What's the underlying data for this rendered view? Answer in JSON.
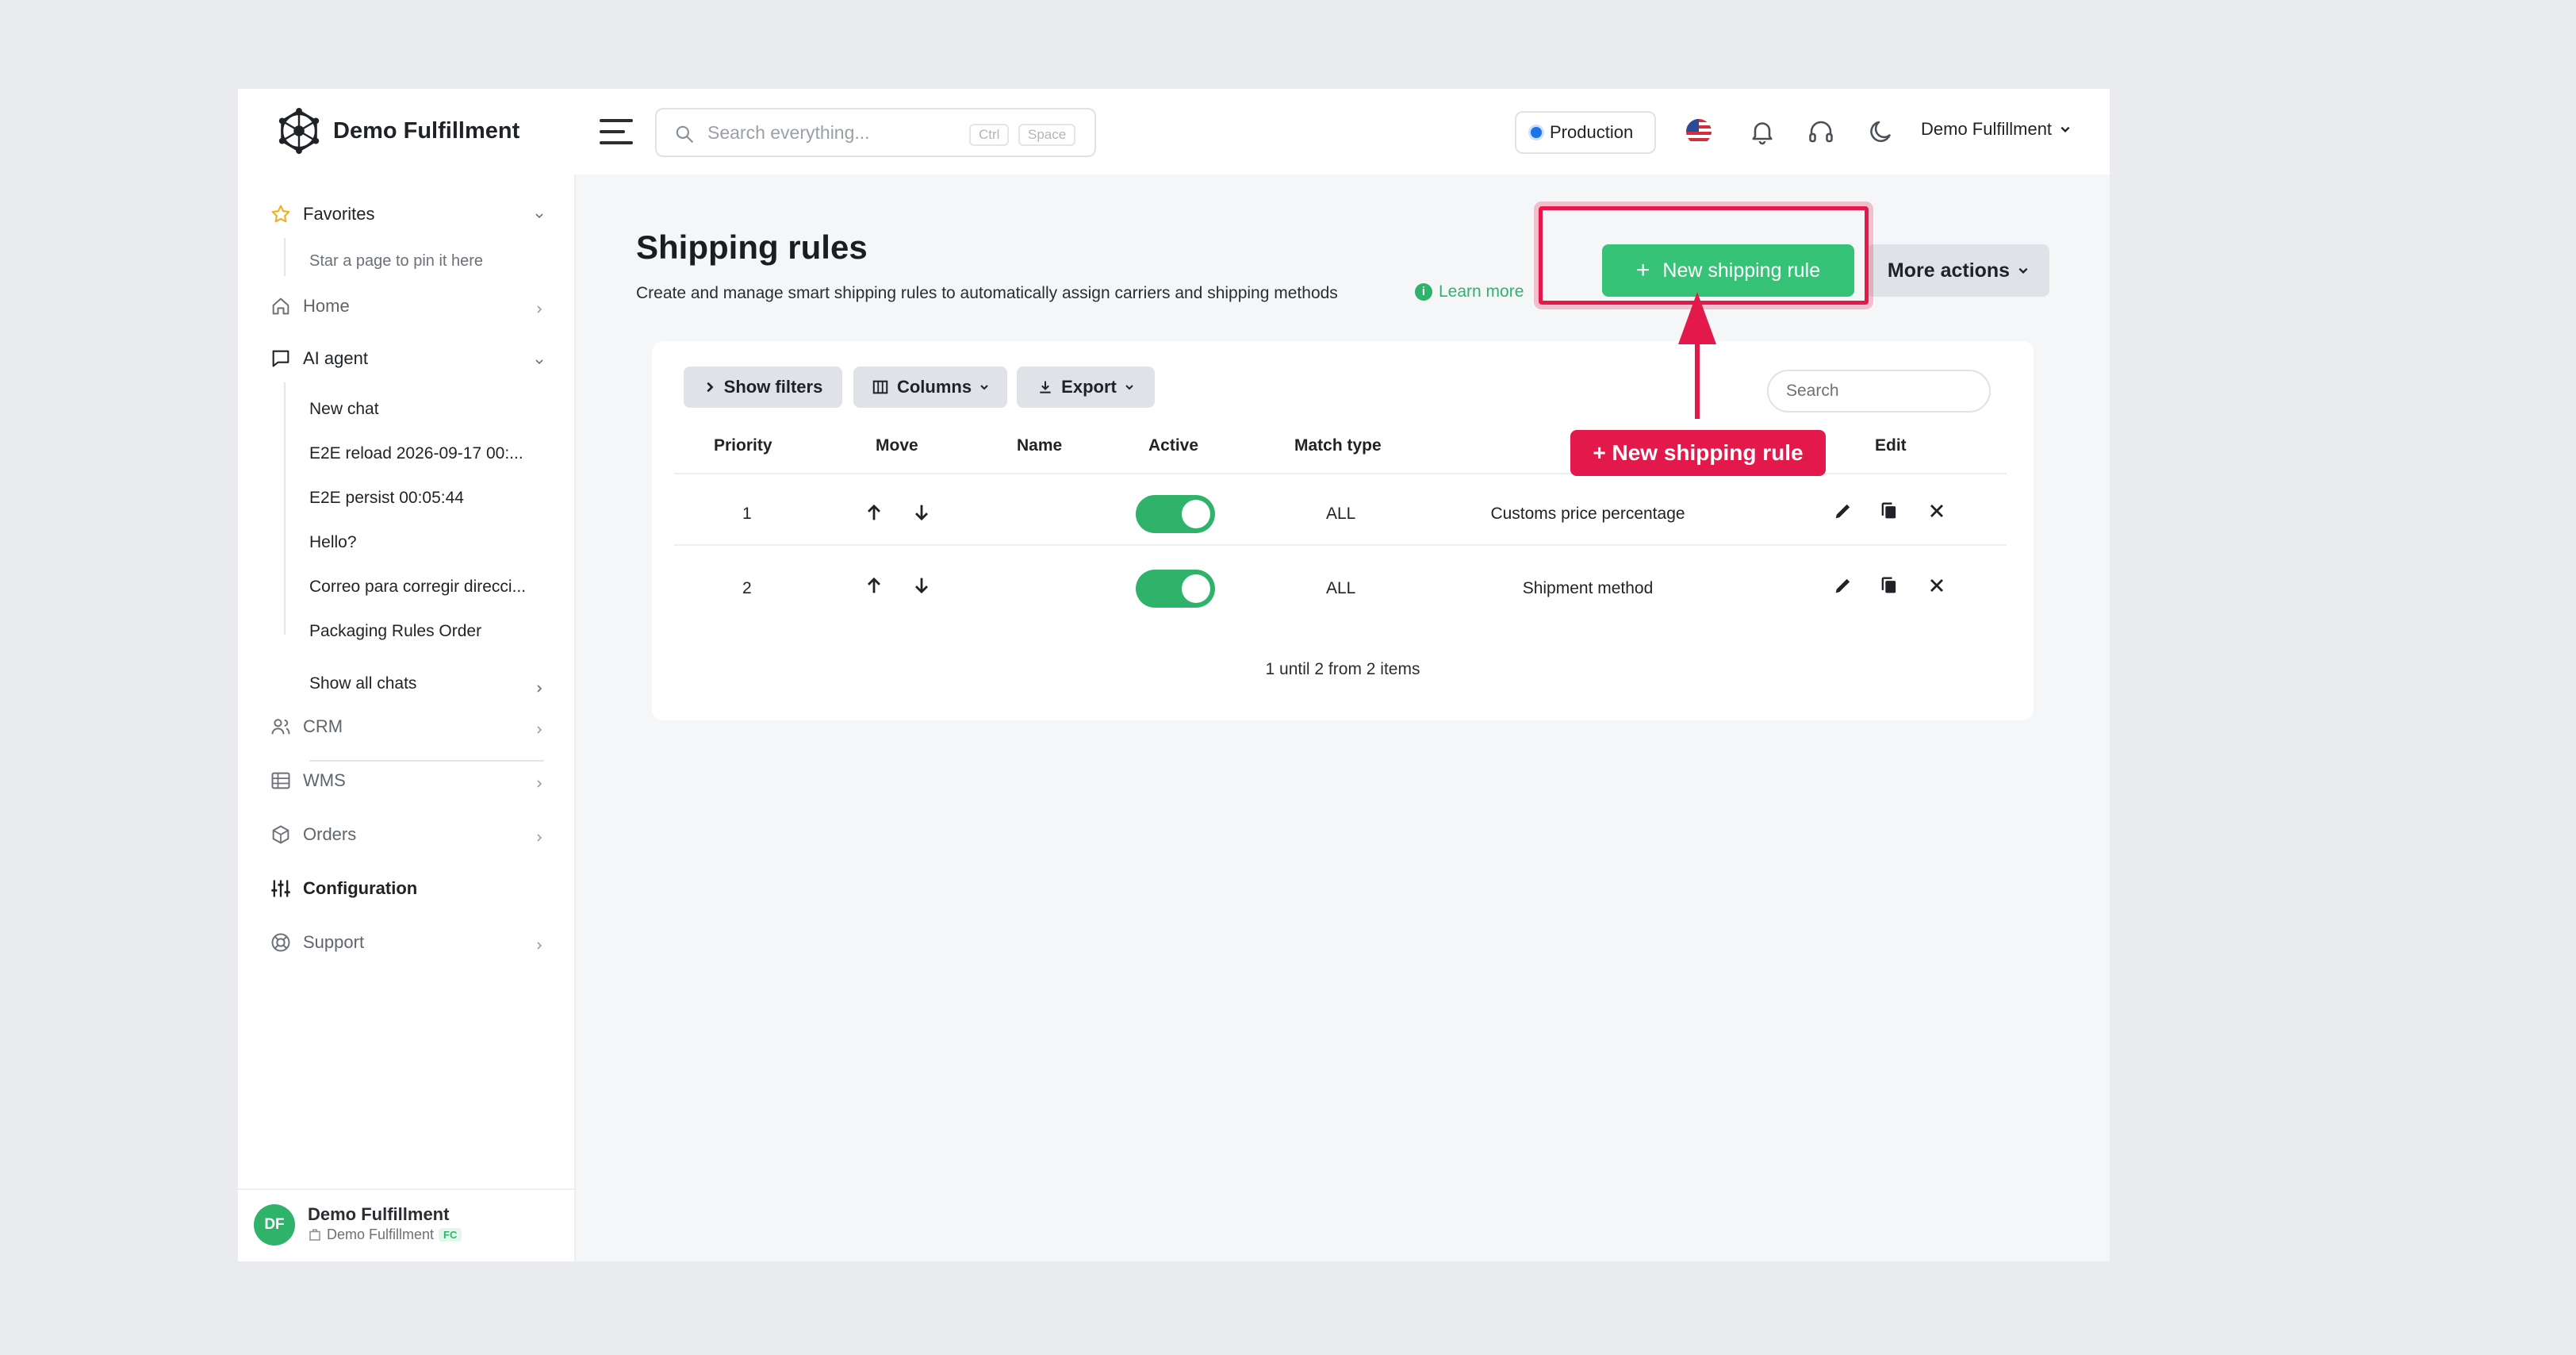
{
  "app": {
    "brand": "Demo Fulfillment",
    "search_placeholder": "Search everything...",
    "search_kbd_1": "Ctrl",
    "search_kbd_2": "Space",
    "environment": "Production",
    "account_name": "Demo Fulfillment"
  },
  "sidebar": {
    "favorites_label": "Favorites",
    "favorites_hint": "Star a page to pin it here",
    "home_label": "Home",
    "ai_agent_label": "AI agent",
    "chats": [
      "New chat",
      "E2E reload 2026-09-17 00:...",
      "E2E persist 00:05:44",
      "Hello?",
      "Correo para corregir direcci...",
      "Packaging Rules Order"
    ],
    "show_all_chats": "Show all chats",
    "crm_label": "CRM",
    "wms_label": "WMS",
    "orders_label": "Orders",
    "configuration_label": "Configuration",
    "support_label": "Support"
  },
  "profile": {
    "initials": "DF",
    "name": "Demo Fulfillment",
    "company": "Demo Fulfillment",
    "badge": "FC"
  },
  "page": {
    "title": "Shipping rules",
    "description": "Create and manage smart shipping rules to automatically assign carriers and shipping methods",
    "learn_more": "Learn more",
    "new_rule_button": "New shipping rule",
    "more_actions_button": "More actions",
    "callout_label": "+ New shipping rule"
  },
  "table": {
    "show_filters": "Show filters",
    "columns": "Columns",
    "export": "Export",
    "search_placeholder": "Search",
    "headers": {
      "priority": "Priority",
      "move": "Move",
      "name": "Name",
      "active": "Active",
      "match_type": "Match type",
      "edit": "Edit"
    },
    "rows": [
      {
        "priority": "1",
        "name": "",
        "active": true,
        "match_type": "ALL",
        "condition": "Customs price percentage"
      },
      {
        "priority": "2",
        "name": "",
        "active": true,
        "match_type": "ALL",
        "condition": "Shipment method"
      }
    ],
    "pagination": "1 until 2 from 2 items"
  },
  "colors": {
    "accent_green": "#37c377",
    "highlight_red": "#e3194b",
    "env_blue": "#1a73e8"
  }
}
